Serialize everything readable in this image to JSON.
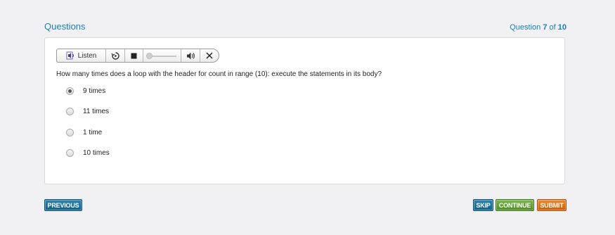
{
  "header": {
    "title": "Questions",
    "progress_prefix": "Question ",
    "progress_current": "7",
    "progress_of": " of ",
    "progress_total": "10"
  },
  "tts": {
    "listen_label": "Listen"
  },
  "question": {
    "text": "How many times does a loop with the header for count in range (10): execute the statements in its body?",
    "options": [
      {
        "label": "9 times",
        "selected": true
      },
      {
        "label": "11 times",
        "selected": false
      },
      {
        "label": "1 time",
        "selected": false
      },
      {
        "label": "10 times",
        "selected": false
      }
    ]
  },
  "buttons": {
    "previous": "PREVIOUS",
    "skip": "SKIP",
    "continue": "CONTINUE",
    "submit": "SUBMIT"
  },
  "colors": {
    "accent": "#1a7fbf",
    "primary_button": "#135f86",
    "continue_button": "#4f8a27",
    "submit_button": "#c8600c"
  },
  "icons": [
    "speaker-listen-icon",
    "replay-icon",
    "stop-icon",
    "volume-icon",
    "close-icon"
  ]
}
